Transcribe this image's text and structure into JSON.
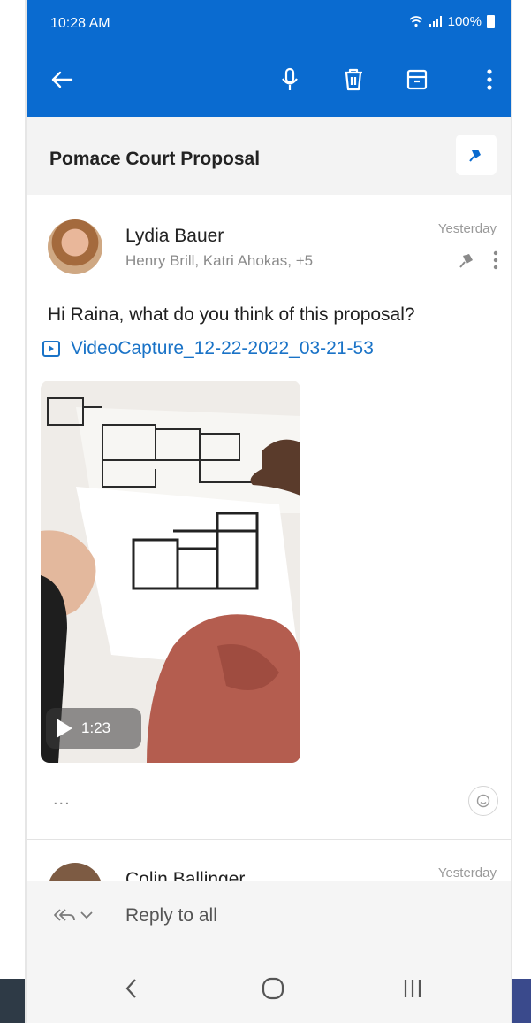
{
  "status_bar": {
    "time": "10:28 AM",
    "battery": "100%"
  },
  "toolbar": {
    "icons": [
      "back-arrow-icon",
      "microphone-icon",
      "delete-icon",
      "archive-icon",
      "more-vertical-icon"
    ]
  },
  "thread": {
    "subject": "Pomace Court Proposal"
  },
  "message": {
    "sender": "Lydia Bauer",
    "recipients": "Henry Brill, Katri Ahokas, +5",
    "date": "Yesterday",
    "body": "Hi Raina, what do you think of this proposal?",
    "attachment_name": "VideoCapture_12-22-2022_03-21-53",
    "video_duration": "1:23",
    "more_label": "..."
  },
  "next_message": {
    "sender": "Colin Ballinger",
    "date": "Yesterday"
  },
  "reply": {
    "label": "Reply to all"
  },
  "colors": {
    "app_bar": "#0a6bd0",
    "link": "#1a73c7"
  }
}
